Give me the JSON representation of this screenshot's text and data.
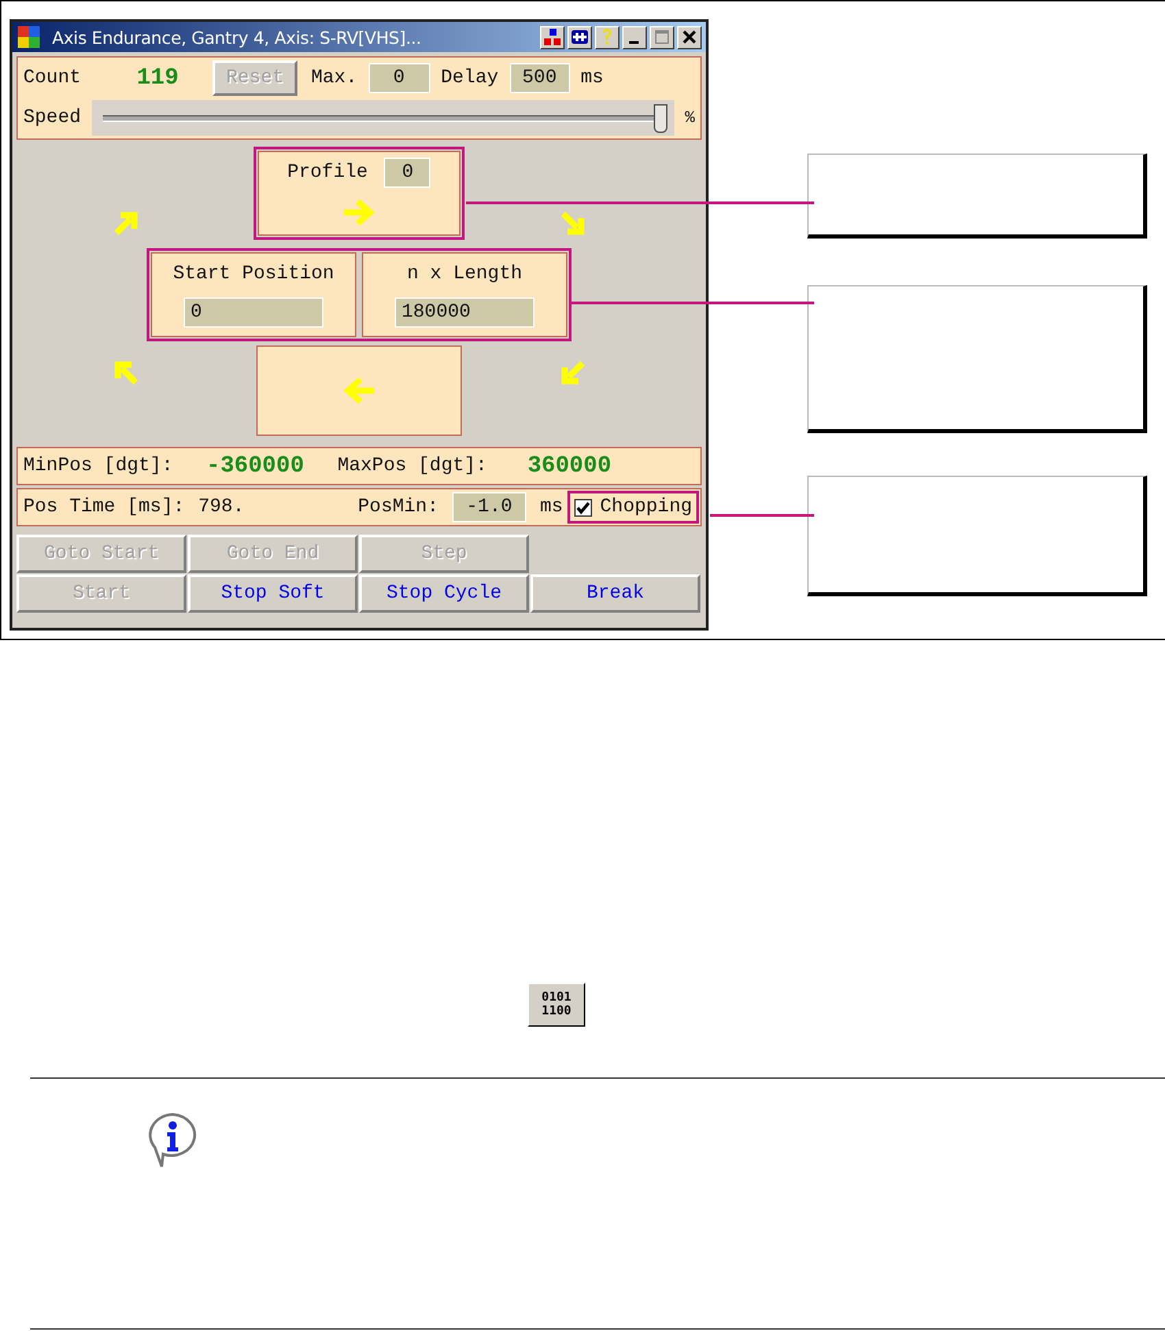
{
  "window": {
    "title": "Axis Endurance, Gantry 4, Axis: S-RV[VHS]..."
  },
  "counter": {
    "count_label": "Count",
    "count": "119",
    "reset": {
      "label": "Reset",
      "disabled": true
    },
    "max_label": "Max.",
    "max": "0",
    "delay_label": "Delay",
    "delay": "500",
    "delay_unit": "ms"
  },
  "speed": {
    "label": "Speed",
    "level": 0.98,
    "unit": "%"
  },
  "profile": {
    "label": "Profile",
    "value": "0"
  },
  "start_position": {
    "label": "Start Position",
    "value": "0"
  },
  "length": {
    "label": "n x Length",
    "value": "180000"
  },
  "limits": {
    "min_label": "MinPos [dgt]:",
    "min": "-360000",
    "max_label": "MaxPos [dgt]:",
    "max": "360000"
  },
  "timing": {
    "pos_time_label": "Pos Time [ms]:",
    "pos_time": "798.",
    "pos_min_label": "PosMin:",
    "pos_min": "-1.0",
    "unit": "ms",
    "chopping": {
      "label": "Chopping",
      "checked": true
    }
  },
  "button_rows": [
    {
      "buttons": [
        {
          "label": "Goto Start",
          "disabled": true
        },
        {
          "label": "Goto End",
          "disabled": true
        },
        {
          "label": "Step",
          "disabled": true
        }
      ]
    },
    {
      "buttons": [
        {
          "label": "Start",
          "disabled": true
        },
        {
          "label": "Stop Soft",
          "disabled": false
        },
        {
          "label": "Stop Cycle",
          "disabled": false
        },
        {
          "label": "Break",
          "disabled": false
        }
      ]
    }
  ],
  "toolbar_icon": {
    "lines": [
      "0101",
      "1100"
    ]
  }
}
